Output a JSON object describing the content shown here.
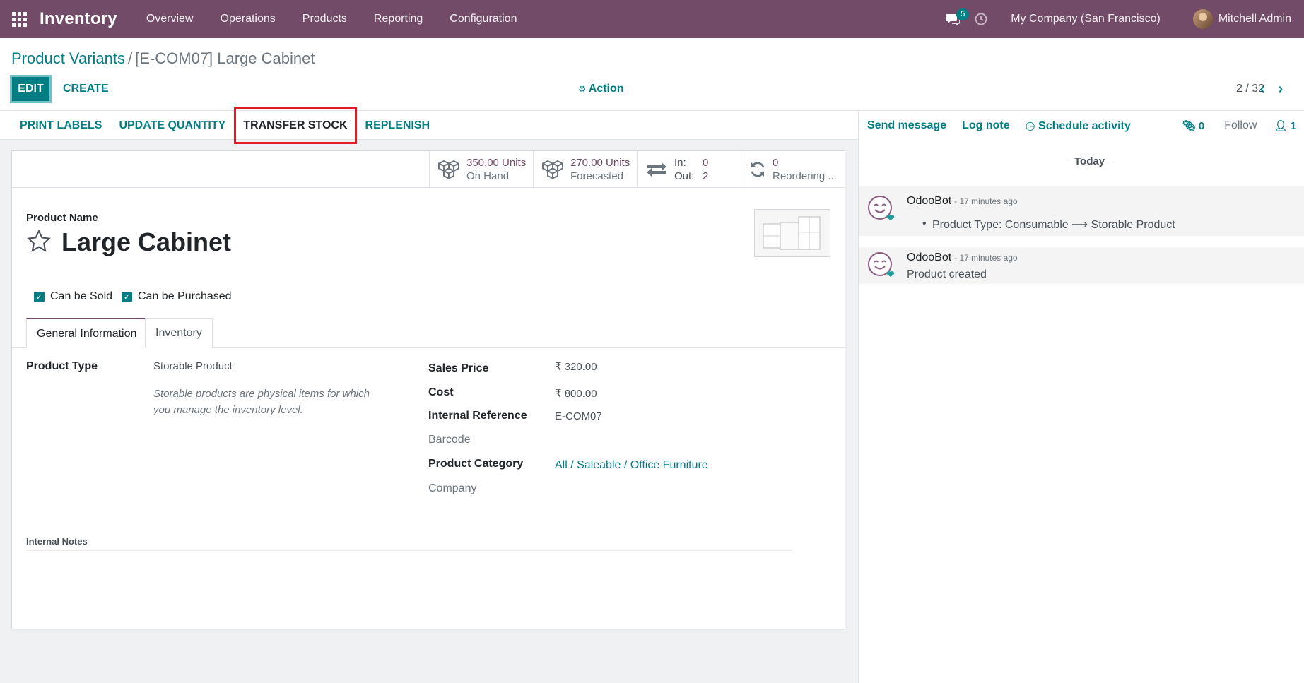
{
  "navbar": {
    "brand": "Inventory",
    "menu": [
      "Overview",
      "Operations",
      "Products",
      "Reporting",
      "Configuration"
    ],
    "messages_count": "5",
    "company": "My Company (San Francisco)",
    "user": "Mitchell Admin"
  },
  "breadcrumb": {
    "parent": "Product Variants",
    "separator": "/",
    "current": "[E-COM07] Large Cabinet"
  },
  "controls": {
    "edit": "EDIT",
    "create": "CREATE",
    "action": "Action",
    "pager": "2 / 32"
  },
  "statusbar": {
    "print_labels": "PRINT LABELS",
    "update_quantity": "UPDATE QUANTITY",
    "transfer_stock": "TRANSFER STOCK",
    "replenish": "REPLENISH"
  },
  "stats": {
    "on_hand_value": "350.00 Units",
    "on_hand_label": "On Hand",
    "forecasted_value": "270.00 Units",
    "forecasted_label": "Forecasted",
    "in_label": "In:",
    "in_value": "0",
    "out_label": "Out:",
    "out_value": "2",
    "reordering_value": "0",
    "reordering_label": "Reordering ..."
  },
  "product": {
    "name_label": "Product Name",
    "name": "Large Cabinet",
    "can_be_sold": "Can be Sold",
    "can_be_purchased": "Can be Purchased"
  },
  "tabs": {
    "general": "General Information",
    "inventory": "Inventory"
  },
  "fields": {
    "product_type_label": "Product Type",
    "product_type": "Storable Product",
    "product_type_help": "Storable products are physical items for which you manage the inventory level.",
    "sales_price_label": "Sales Price",
    "sales_price": "₹ 320.00",
    "cost_label": "Cost",
    "cost": "₹ 800.00",
    "internal_ref_label": "Internal Reference",
    "internal_ref": "E-COM07",
    "barcode_label": "Barcode",
    "category_label": "Product Category",
    "category": "All / Saleable / Office Furniture",
    "company_label": "Company",
    "internal_notes_label": "Internal Notes"
  },
  "chatter": {
    "send_message": "Send message",
    "log_note": "Log note",
    "schedule_activity": "Schedule activity",
    "attachments": "0",
    "follow": "Follow",
    "followers": "1",
    "today": "Today",
    "messages": [
      {
        "author": "OdooBot",
        "time": "- 17 minutes ago",
        "change_from": "Product Type: Consumable",
        "arrow": "⟶",
        "change_to": "Storable Product"
      },
      {
        "author": "OdooBot",
        "time": "- 17 minutes ago",
        "body": "Product created"
      }
    ]
  },
  "colors": {
    "brand": "#714b67",
    "primary": "#017e84",
    "highlight": "#e01b24"
  }
}
